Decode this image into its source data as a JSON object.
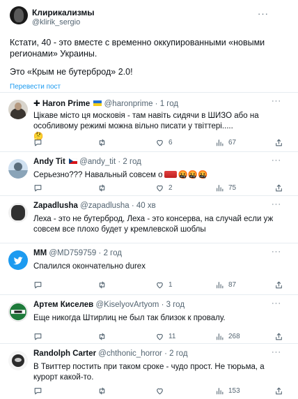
{
  "main": {
    "name": "Клирикализмы",
    "handle": "@klirik_sergio",
    "text1": "Кстати, 40 - это вместе с временно оккупированными «новыми регионами» Украины.",
    "text2": "Это «Крым не бутерброд» 2.0!",
    "translate": "Перевести пост"
  },
  "colors": {
    "accent": "#1d9bf0",
    "muted": "#536471",
    "divider": "#e6ecf0"
  },
  "replies": [
    {
      "name": "✚ Haron Prime",
      "flag": "ukraine",
      "handle": "@haronprime",
      "time": "1 год",
      "text": "Цікаве місто ця московія - там навіть сидячи в ШИЗО або на особливому режимі можна вільно писати у твіттері.....",
      "emoji": "🤔",
      "replies": "",
      "retweets": "",
      "likes": "6",
      "views": "67"
    },
    {
      "name": "Andy Tit",
      "flag": "czech",
      "handle": "@andy_tit",
      "time": "2 год",
      "text": "Серьезно??? Навальный совсем о",
      "emoji": "🤬🤬🤬",
      "replies": "",
      "retweets": "",
      "likes": "2",
      "views": "75"
    },
    {
      "name": "Zapadlusha",
      "handle": "@zapadlusha",
      "time": "40 хв",
      "text": "Леха - это не бутерброд, Леха - это консерва, на случай если уж совсем все плохо будет у кремлевской шоблы",
      "replies": "",
      "retweets": "",
      "likes": "",
      "views": ""
    },
    {
      "name": "MM",
      "handle": "@MD759759",
      "time": "2 год",
      "text": "Спалился окончательно durex",
      "replies": "",
      "retweets": "",
      "likes": "1",
      "views": "87"
    },
    {
      "name": "Артем Киселев",
      "handle": "@KiselyovArtyom",
      "time": "3 год",
      "text": "Еще никогда Штирлиц не был так близок к провалу.",
      "replies": "",
      "retweets": "",
      "likes": "11",
      "views": "268"
    },
    {
      "name": "Randolph Carter",
      "handle": "@chthonic_horror",
      "time": "2 год",
      "text": "В Твиттер постить при таком сроке - чудо прост. Не тюрьма, а курорт какой-то.",
      "replies": "",
      "retweets": "",
      "likes": "",
      "views": "153"
    }
  ]
}
